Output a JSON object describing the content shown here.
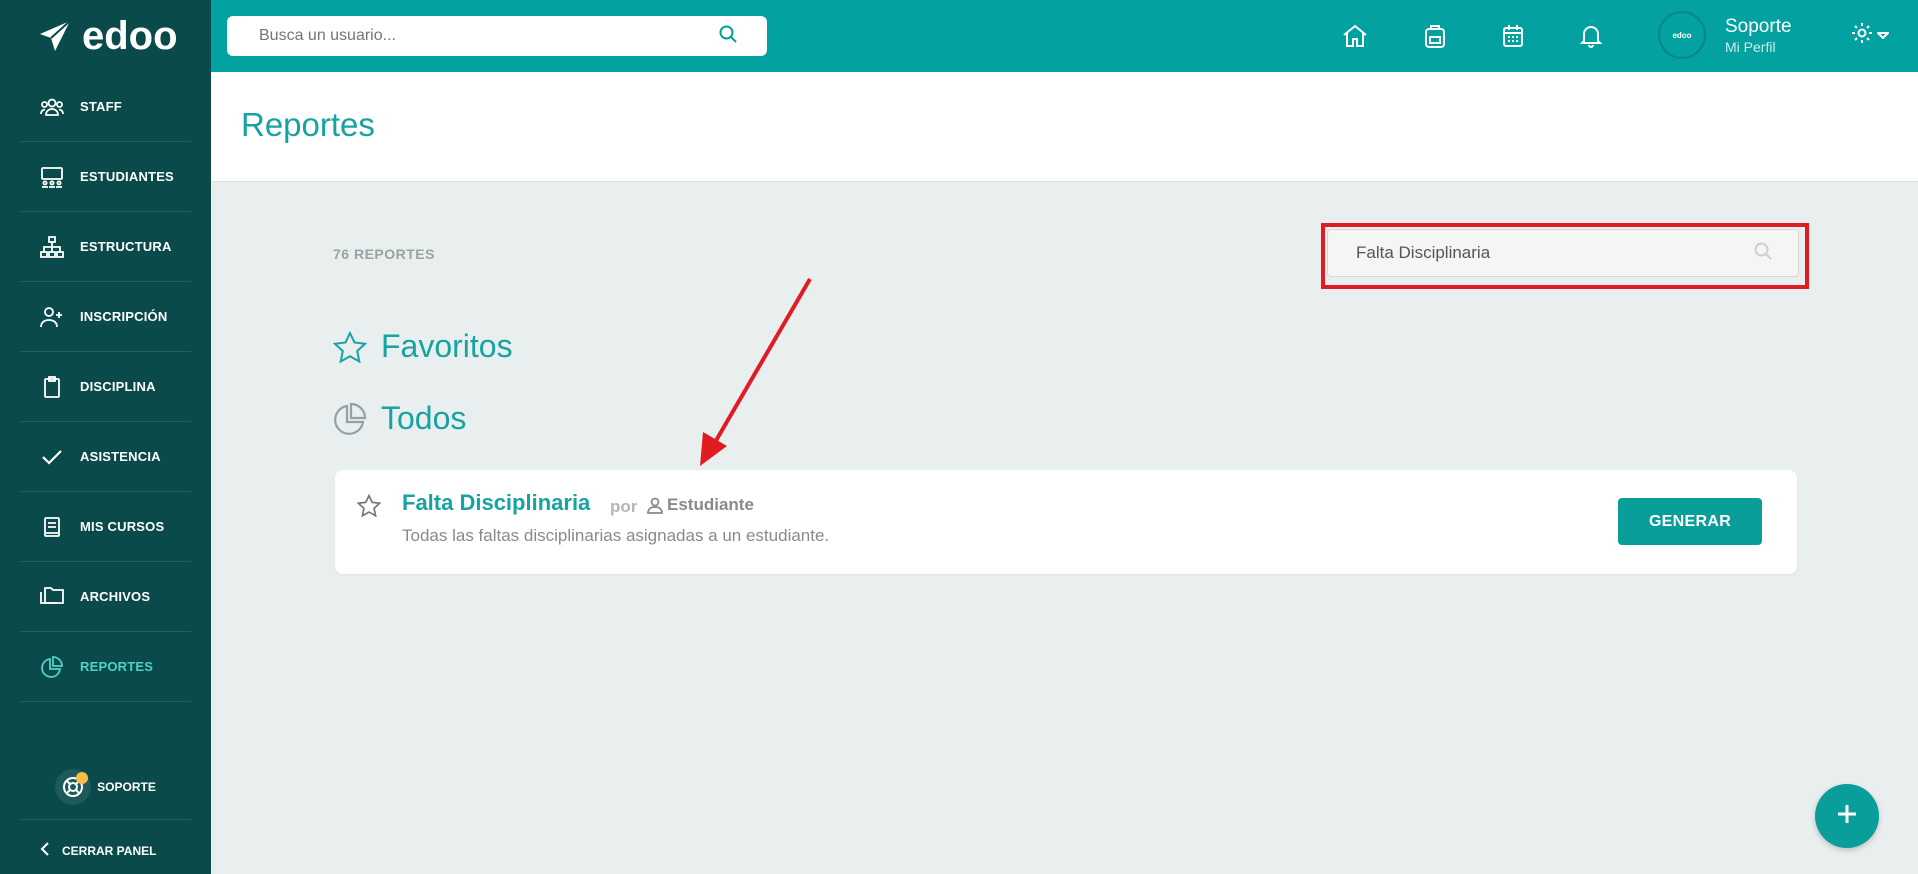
{
  "app": {
    "name": "edoo"
  },
  "colors": {
    "teal": "#03a19f",
    "sidebar": "#0b4a4b",
    "accent": "#4fd1c9",
    "highlight_red": "#e11b22"
  },
  "search": {
    "placeholder": "Busca un usuario..."
  },
  "sidebar": {
    "items": [
      {
        "label": "STAFF",
        "icon": "users-icon"
      },
      {
        "label": "ESTUDIANTES",
        "icon": "classroom-icon"
      },
      {
        "label": "ESTRUCTURA",
        "icon": "hierarchy-icon"
      },
      {
        "label": "INSCRIPCIÓN",
        "icon": "add-user-icon"
      },
      {
        "label": "DISCIPLINA",
        "icon": "clipboard-icon"
      },
      {
        "label": "ASISTENCIA",
        "icon": "check-icon"
      },
      {
        "label": "MIS CURSOS",
        "icon": "book-icon"
      },
      {
        "label": "ARCHIVOS",
        "icon": "folders-icon"
      },
      {
        "label": "REPORTES",
        "icon": "pie-chart-icon",
        "active": true
      }
    ],
    "support": "SOPORTE",
    "close_panel": "CERRAR PANEL"
  },
  "topbar": {
    "icons": [
      "home-icon",
      "backpack-icon",
      "calendar-icon",
      "bell-icon"
    ],
    "user": {
      "name": "Soporte",
      "subtitle": "Mi Perfil",
      "avatar_text": "edoo"
    }
  },
  "page": {
    "title": "Reportes",
    "count": "76 REPORTES",
    "filter_value": "Falta Disciplinaria",
    "favorites_label": "Favoritos",
    "all_label": "Todos"
  },
  "report": {
    "title": "Falta Disciplinaria",
    "por": "por",
    "audience": "Estudiante",
    "description": "Todas las faltas disciplinarias asignadas a un estudiante.",
    "button": "GENERAR"
  }
}
